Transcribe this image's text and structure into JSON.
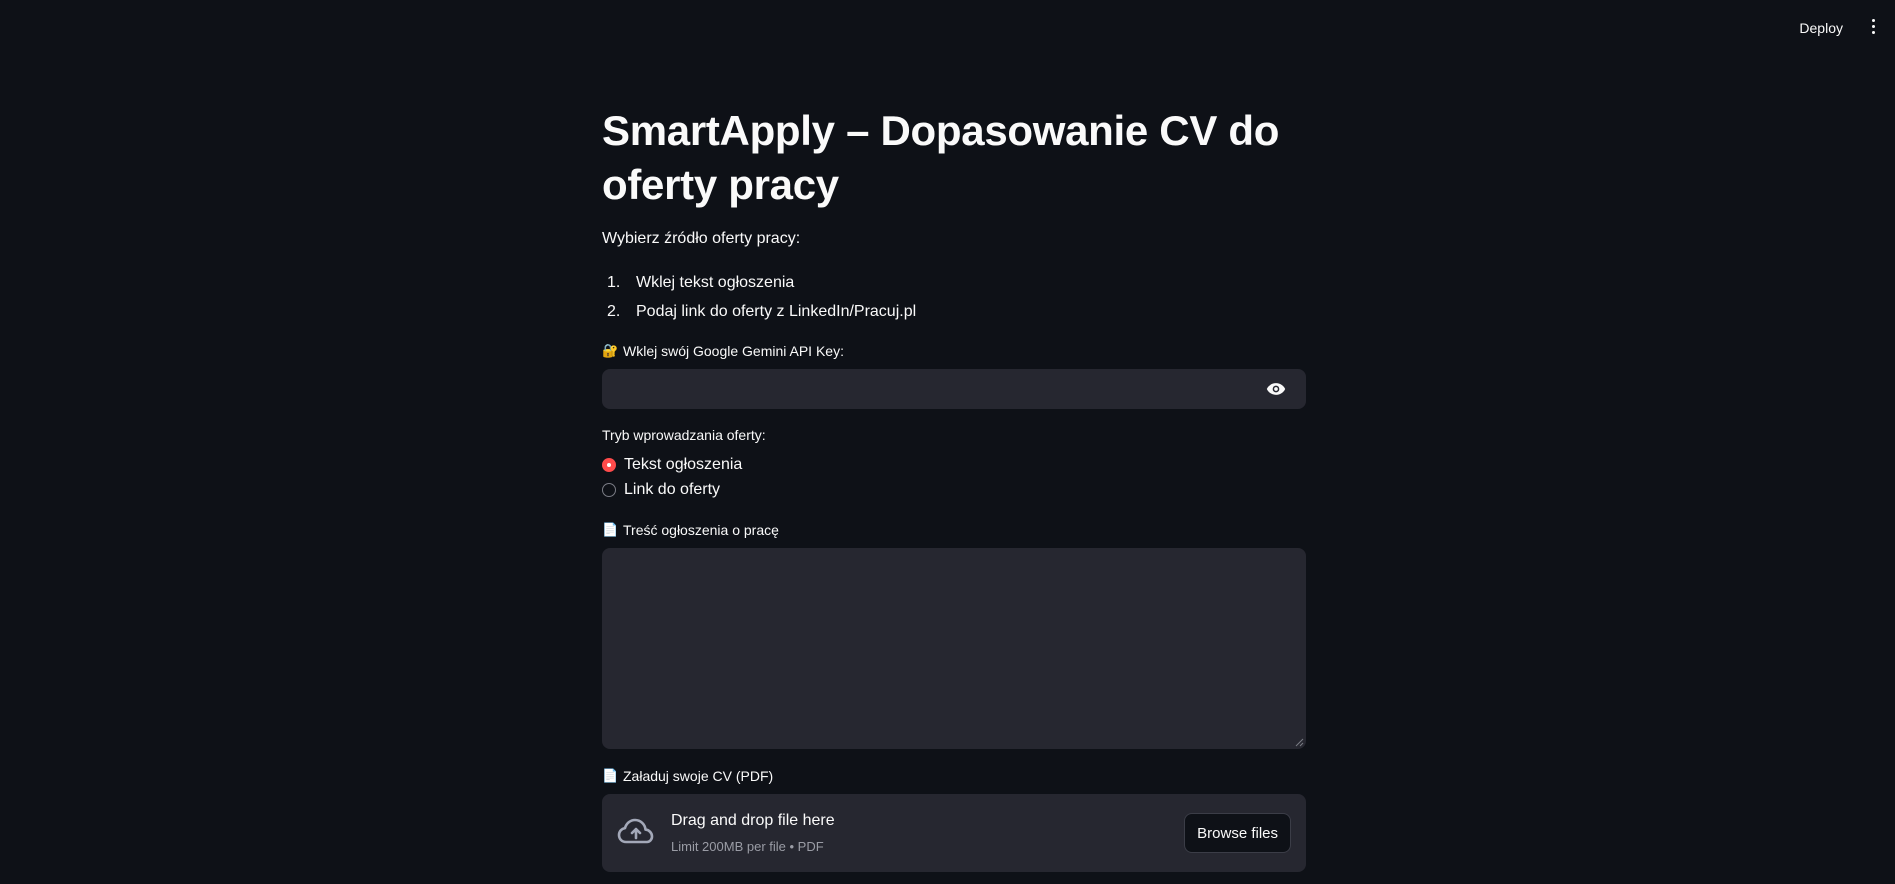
{
  "header": {
    "deploy_label": "Deploy",
    "menu_icon": "kebab-menu-icon"
  },
  "main": {
    "title": "SmartApply – Dopasowanie CV do oferty pracy",
    "intro": "Wybierz źródło oferty pracy:",
    "steps": [
      {
        "num": "1.",
        "text": "Wklej tekst ogłoszenia"
      },
      {
        "num": "2.",
        "text": "Podaj link do oferty z LinkedIn/Pracuj.pl"
      }
    ],
    "api_key": {
      "emoji": "🔐",
      "label": "Wklej swój Google Gemini API Key:",
      "value": "",
      "placeholder": ""
    },
    "mode": {
      "label": "Tryb wprowadzania oferty:",
      "options": [
        "Tekst ogłoszenia",
        "Link do oferty"
      ],
      "selected": "Tekst ogłoszenia"
    },
    "job_text": {
      "emoji": "📄",
      "label": "Treść ogłoszenia o pracę",
      "value": ""
    },
    "cv_upload": {
      "emoji": "📄",
      "label": "Załaduj swoje CV (PDF)",
      "drop_title": "Drag and drop file here",
      "drop_limit": "Limit 200MB per file • PDF",
      "browse_label": "Browse files"
    }
  },
  "colors": {
    "background": "#0e1117",
    "input_bg": "#262730",
    "accent": "#ff4b4b",
    "text": "#fafafa"
  }
}
